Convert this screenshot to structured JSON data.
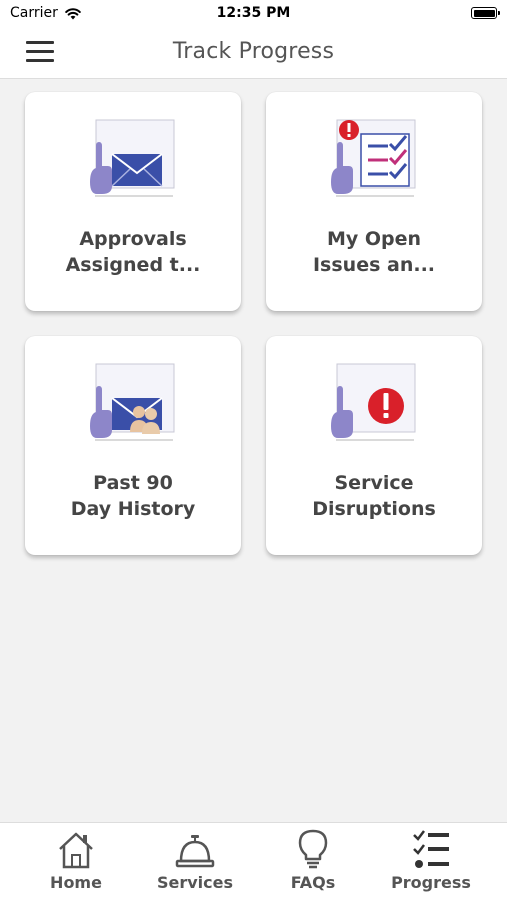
{
  "status_bar": {
    "carrier": "Carrier",
    "time": "12:35 PM"
  },
  "nav": {
    "title": "Track Progress",
    "menu_icon": "hamburger-menu-icon"
  },
  "tiles": [
    {
      "line1": "Approvals",
      "line2": "Assigned t...",
      "icon": "envelope-hand-icon"
    },
    {
      "line1": "My Open",
      "line2": "Issues an...",
      "icon": "checklist-alert-icon"
    },
    {
      "line1": "Past 90",
      "line2": "Day History",
      "icon": "envelope-people-icon"
    },
    {
      "line1": "Service",
      "line2": "Disruptions",
      "icon": "alert-hand-icon"
    }
  ],
  "tab_bar": {
    "items": [
      {
        "label": "Home",
        "icon": "home-icon"
      },
      {
        "label": "Services",
        "icon": "service-bell-icon"
      },
      {
        "label": "FAQs",
        "icon": "lightbulb-icon"
      },
      {
        "label": "Progress",
        "icon": "checklist-icon"
      }
    ]
  },
  "colors": {
    "background": "#f2f2f2",
    "card": "#ffffff",
    "label_text": "#454545",
    "envelope_blue": "#3a4fa8",
    "alert_red": "#d9202a",
    "hand_purple": "#8d86c9"
  }
}
